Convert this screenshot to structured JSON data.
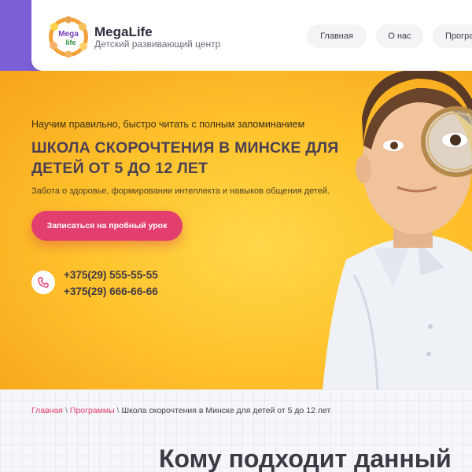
{
  "header": {
    "brand_name": "MegaLife",
    "brand_subtitle": "Детский развивающий центр",
    "logo_text_top": "Mega",
    "logo_text_bottom": "life"
  },
  "nav": {
    "items": [
      {
        "label": "Главная"
      },
      {
        "label": "О нас"
      },
      {
        "label": "Програ"
      }
    ]
  },
  "hero": {
    "tagline": "Научим правильно, быстро читать с полным запоминанием",
    "headline": "ШКОЛА СКОРОЧТЕНИЯ  В МИНСКЕ  ДЛЯ ДЕТЕЙ  ОТ 5 ДО 12 ЛЕТ",
    "lead": "Забота о здоровье, формировании интеллекта и навыков общения детей.",
    "cta_label": "Записаться на пробный урок",
    "phone_1": "+375(29) 555-55-55",
    "phone_2": "+375(29) 666-66-66"
  },
  "breadcrumb": {
    "home": "Главная",
    "sep1": "\\",
    "programs": "Программы",
    "sep2": "\\",
    "current": "Школа скорочтения в Минске для детей от 5 до 12 лет"
  },
  "section": {
    "title": "Кому подходит данный"
  },
  "colors": {
    "accent": "#e23f6e",
    "hero_yellow": "#ffc42e",
    "top_strip": "#7d5fd8"
  }
}
